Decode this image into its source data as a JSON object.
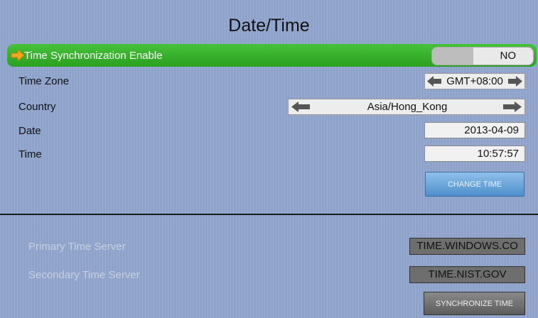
{
  "page": {
    "title": "Date/Time"
  },
  "sync": {
    "label": "Time Synchronization Enable",
    "value": "NO"
  },
  "timezone": {
    "label": "Time Zone",
    "value": "GMT+08:00"
  },
  "country": {
    "label": "Country",
    "value": "Asia/Hong_Kong"
  },
  "date": {
    "label": "Date",
    "value": "2013-04-09"
  },
  "time": {
    "label": "Time",
    "value": "10:57:57"
  },
  "change_time_button": "CHANGE TIME",
  "primary_server": {
    "label": "Primary Time Server",
    "value": "TIME.WINDOWS.CO"
  },
  "secondary_server": {
    "label": "Secondary Time Server",
    "value": "TIME.NIST.GOV"
  },
  "synchronize_button": "SYNCHRONIZE TIME",
  "colors": {
    "highlight": "#2aa11f",
    "accent_button": "#4e8fcc",
    "background": "#8ea3cc"
  }
}
